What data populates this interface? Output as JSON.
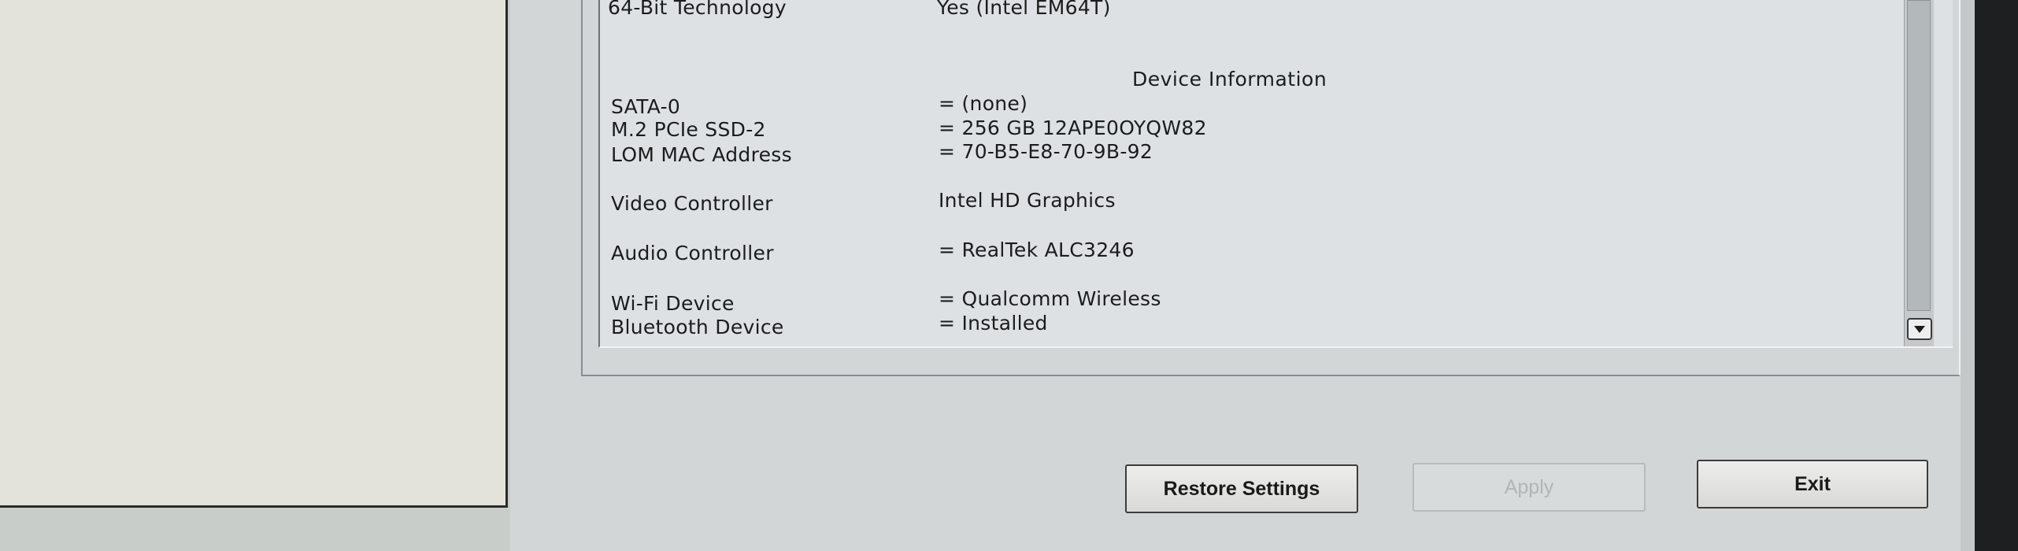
{
  "system_info": {
    "rows": [
      {
        "label": "64-Bit Technology",
        "value": "Yes (Intel EM64T)"
      }
    ]
  },
  "device_info": {
    "title": "Device Information",
    "rows": [
      {
        "label": "SATA-0",
        "value": "= (none)"
      },
      {
        "label": "M.2 PCIe SSD-2",
        "value": "= 256 GB 12APE0OYQW82"
      },
      {
        "label": "LOM MAC Address",
        "value": "= 70-B5-E8-70-9B-92"
      },
      {
        "label": "Video Controller",
        "value": "Intel HD Graphics"
      },
      {
        "label": "Audio Controller",
        "value": "= RealTek ALC3246"
      },
      {
        "label": "Wi-Fi Device",
        "value": "= Qualcomm Wireless"
      },
      {
        "label": "Bluetooth Device",
        "value": "= Installed"
      }
    ]
  },
  "buttons": {
    "restore": "Restore Settings",
    "apply": "Apply",
    "exit": "Exit"
  },
  "scrollbar": {
    "down_icon": "chevron-down-icon"
  }
}
